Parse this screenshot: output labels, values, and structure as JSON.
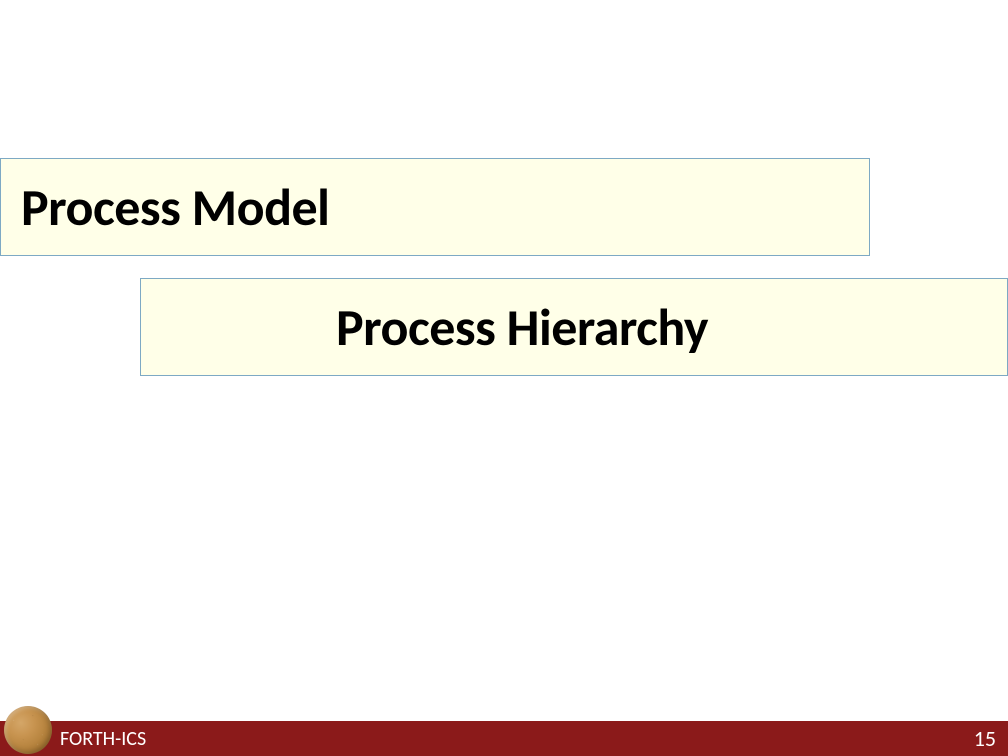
{
  "slide": {
    "title": "Process Model",
    "subtitle": "Process Hierarchy"
  },
  "footer": {
    "organization": "FORTH-ICS",
    "page_number": "15"
  }
}
